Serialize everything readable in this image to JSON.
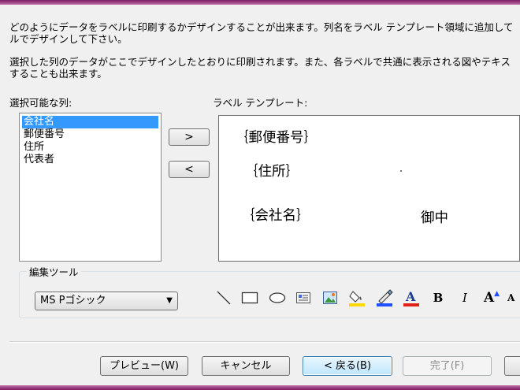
{
  "description": {
    "line1": "どのようにデータをラベルに印刷するかデザインすることが出来ます。列名をラベル テンプレート領域に追加して",
    "line2": "ルでデザインして下さい。",
    "line3": "選択した列のデータがここでデザインしたとおりに印刷されます。また、各ラベルで共通に表示される図やテキス",
    "line4": "することも出来ます。"
  },
  "columns": {
    "label": "選択可能な列:",
    "items": [
      "会社名",
      "郵便番号",
      "住所",
      "代表者"
    ],
    "selected_index": 0
  },
  "move_buttons": {
    "add": ">",
    "remove": "<"
  },
  "template": {
    "label": "ラベル テンプレート:",
    "field_postal": "｛郵便番号｝",
    "field_address": "｛住所｝",
    "field_company": "｛会社名｝",
    "suffix": "御中"
  },
  "edit_tools": {
    "label": "編集ツール",
    "font_value": "MS Pゴシック",
    "tools": [
      "line-tool-icon",
      "rectangle-tool-icon",
      "ellipse-tool-icon",
      "textbox-tool-icon",
      "image-tool-icon",
      "fill-color-icon",
      "line-color-icon",
      "font-color-icon",
      "bold-icon",
      "italic-icon",
      "grow-font-icon",
      "shrink-font-icon"
    ],
    "bold_glyph": "B",
    "italic_glyph": "I",
    "grow_glyph": "A",
    "shrink_glyph": "A"
  },
  "footer": {
    "preview": "プレビュー(W)",
    "cancel": "キャンセル",
    "back": "< 戻る(B)",
    "finish": "完了(F)"
  },
  "colors": {
    "selection": "#3399ff",
    "fill_yellow": "#ffd800",
    "line_blue": "#1f4fff",
    "font_red": "#e0201a"
  }
}
